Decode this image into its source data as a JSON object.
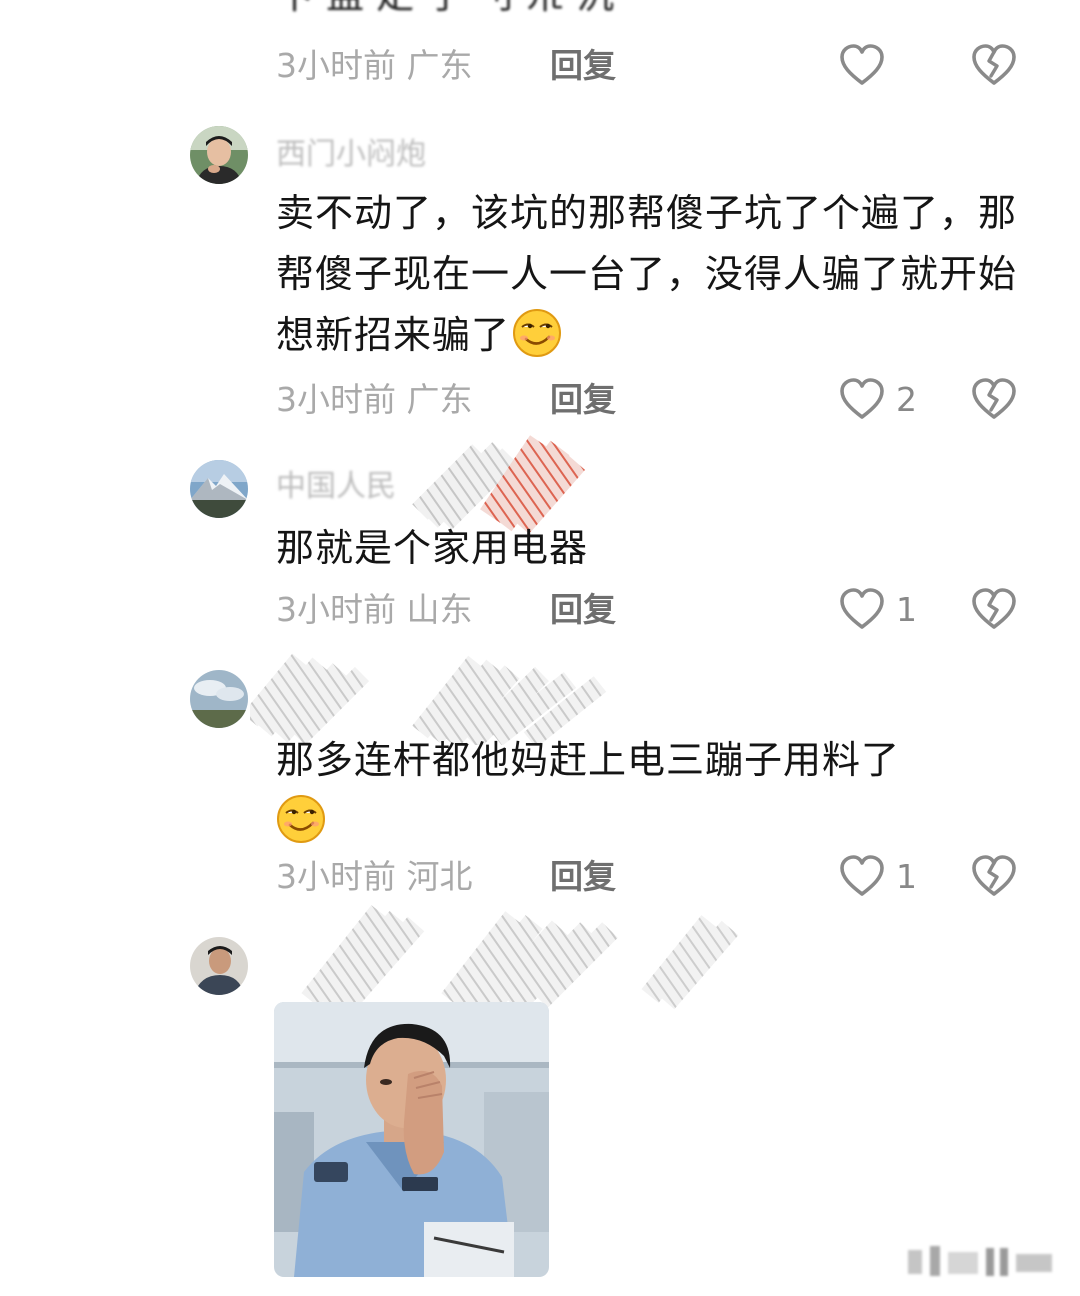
{
  "comments": [
    {
      "meta": {
        "time": "3小时前",
        "location": "广东",
        "reply": "回复",
        "likes": ""
      }
    },
    {
      "username": "西门小闷炮",
      "text": "卖不动了，该坑的那帮傻子坑了个遍了，那帮傻子现在一人一台了，没得人骗了就开始想新招来骗了",
      "emoji": "smirk-emoji",
      "meta": {
        "time": "3小时前",
        "location": "广东",
        "reply": "回复",
        "likes": "2"
      }
    },
    {
      "username": "中国人民",
      "text": "那就是个家用电器",
      "meta": {
        "time": "3小时前",
        "location": "山东",
        "reply": "回复",
        "likes": "1"
      }
    },
    {
      "username": "",
      "text": "那多连杆都他妈赶上电三蹦子用料了",
      "emoji": "smirk-emoji",
      "meta": {
        "time": "3小时前",
        "location": "河北",
        "reply": "回复",
        "likes": "1"
      }
    },
    {
      "username": "",
      "image": "police-officer-facepalm-photo"
    }
  ],
  "icons": {
    "like": "heart-outline-icon",
    "dislike": "broken-heart-icon"
  },
  "colors": {
    "meta_text": "#a9a9a9",
    "reply_text": "#6f6f6f",
    "icon_stroke": "#8a8a8a",
    "body_text": "#151515"
  }
}
